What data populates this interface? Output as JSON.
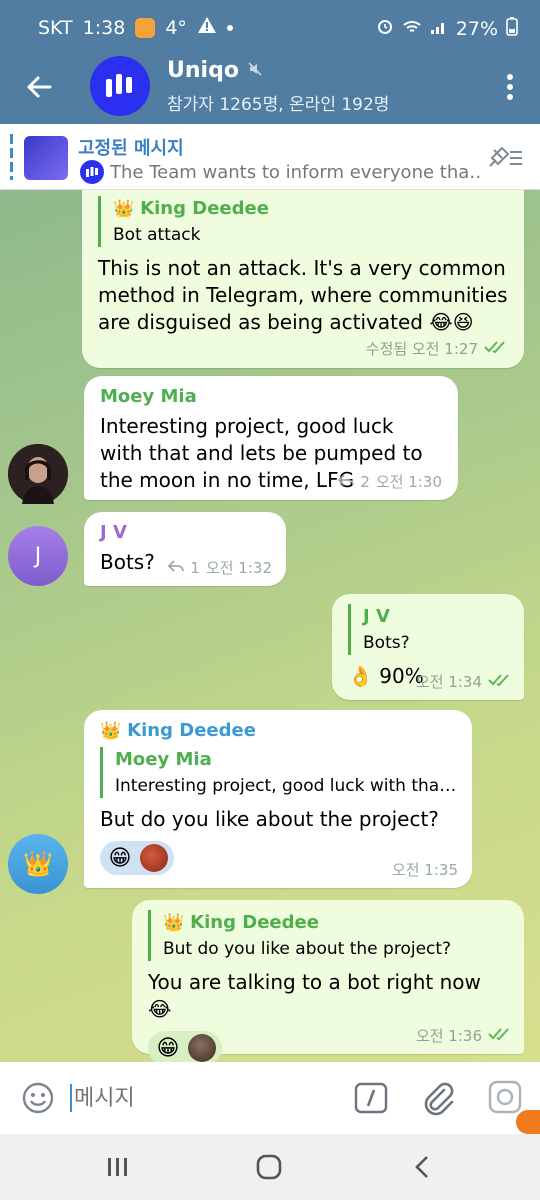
{
  "status": {
    "carrier": "SKT",
    "time": "1:38",
    "temp": "4°",
    "battery": "27%"
  },
  "header": {
    "title": "Uniqo",
    "subtitle": "참가자 1265명, 온라인 192명"
  },
  "pinned": {
    "title": "고정된 메시지",
    "text": "The Team wants to inform everyone tha…"
  },
  "messages": [
    {
      "reply_name": "King Deedee",
      "reply_text": "Bot attack",
      "text": "This is not an attack. It's a very common method in Telegram, where communities are disguised as being activated 😂😆",
      "meta": "수정됨 오전 1:27"
    },
    {
      "name": "Moey Mia",
      "text": "Interesting project, good luck with that and lets be pumped to the moon in no time, LFG",
      "replies": "2",
      "meta": "오전 1:30"
    },
    {
      "avatar_letter": "J",
      "name": "J V",
      "text": "Bots?",
      "replies": "1",
      "meta": "오전 1:32"
    },
    {
      "reply_name": "J V",
      "reply_text": "Bots?",
      "text": "👌 90%",
      "meta": "오전 1:34"
    },
    {
      "name": "King Deedee",
      "reply_name": "Moey Mia",
      "reply_text": "Interesting project, good luck with tha…",
      "text": "But do you like about the project?",
      "reaction": "😁",
      "meta": "오전 1:35"
    },
    {
      "reply_name": "King Deedee",
      "reply_text": "But do you like about the project?",
      "text": "You are talking to a bot right now 😂",
      "reaction": "😁",
      "meta": "오전 1:36"
    }
  ],
  "input": {
    "placeholder": "메시지"
  },
  "colors": {
    "header": "#517da2",
    "name_green": "#4fae4e",
    "name_blue": "#3a9bd4",
    "name_purple": "#9b6bd3",
    "out_bubble": "#effdde"
  }
}
